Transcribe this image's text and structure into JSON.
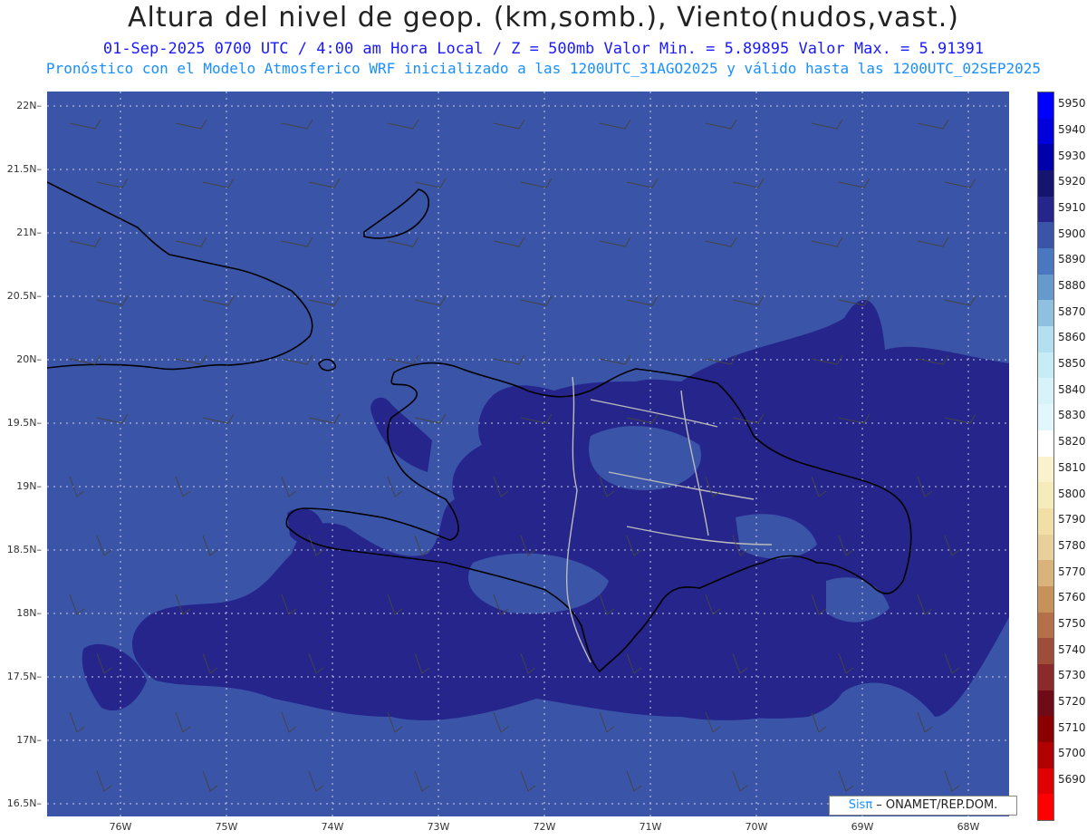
{
  "title": "Altura del nivel de geop. (km,somb.), Viento(nudos,vast.)",
  "subtitle": "01-Sep-2025  0700 UTC / 4:00 am Hora Local / Z = 500mb    Valor Min. = 5.89895  Valor Max. = 5.91391",
  "info": "Pronóstico con el Modelo Atmosferico WRF inicializado a las 1200UTC_31AGO2025 y válido hasta las  1200UTC_02SEP2025",
  "credit": {
    "brand": "Sisπ",
    "text": " – ONAMET/REP.DOM."
  },
  "lat_labels": [
    "22N",
    "21.5N",
    "21N",
    "20.5N",
    "20N",
    "19.5N",
    "19N",
    "18.5N",
    "18N",
    "17.5N",
    "17N",
    "16.5N"
  ],
  "lon_labels": [
    "76W",
    "75W",
    "74W",
    "73W",
    "72W",
    "71W",
    "70W",
    "69W",
    "68W"
  ],
  "colorbar": {
    "labels": [
      "5950",
      "5940",
      "5930",
      "5920",
      "5910",
      "5900",
      "5890",
      "5880",
      "5870",
      "5860",
      "5850",
      "5840",
      "5830",
      "5820",
      "5810",
      "5800",
      "5790",
      "5780",
      "5770",
      "5760",
      "5750",
      "5740",
      "5730",
      "5720",
      "5710",
      "5700",
      "5690"
    ],
    "colors": [
      "#0000ff",
      "#0000dd",
      "#0000aa",
      "#151570",
      "#25258c",
      "#3a55a8",
      "#4a78c0",
      "#6699cc",
      "#8fc0e0",
      "#b2e0f0",
      "#c8ecf6",
      "#d8f2fa",
      "#e2f7fb",
      "#ffffff",
      "#faf2cc",
      "#f6ebbb",
      "#f1dfa6",
      "#e8d09a",
      "#d9b27c",
      "#c7915b",
      "#b47048",
      "#9e4e38",
      "#8a2a2a",
      "#6e0b16",
      "#8a0000",
      "#b00000",
      "#e00000",
      "#ff0000"
    ]
  },
  "colors": {
    "background": "#3a55a8",
    "dark_fill": "#25258c",
    "coast": "#000000",
    "borders": "#bbbbbb"
  }
}
